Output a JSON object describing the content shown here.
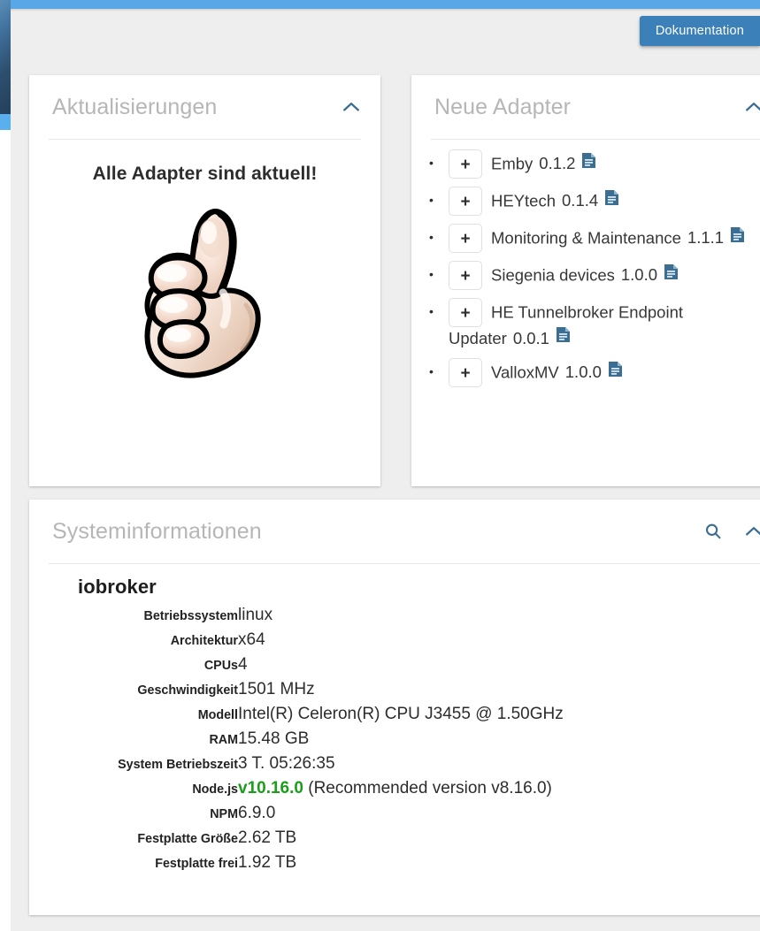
{
  "theme": {
    "topbar_color": "#5aa7e8",
    "sidebar_gradient_top": "#5b8fba",
    "sidebar_gradient_bottom": "#24405c",
    "sidebar_active_color": "#5aafef",
    "page_bg": "#eeeeee",
    "card_bg": "#ffffff",
    "accent_button_color": "#3b80b8",
    "icon_blue": "#3c6e92",
    "card_title_color": "#b6b6b6",
    "node_ok_color": "#1a9e1a"
  },
  "header": {
    "documentation_button_label": "Dokumentation"
  },
  "updates_card": {
    "title": "Aktualisierungen",
    "collapse_icon": "chevron-up-icon",
    "message": "Alle Adapter sind aktuell!",
    "illustration": "thumbs-up-icon"
  },
  "adapters_card": {
    "title": "Neue Adapter",
    "collapse_icon": "chevron-up-icon",
    "add_button_label": "+",
    "doc_icon": "document-icon",
    "items": [
      {
        "name": "Emby",
        "version": "0.1.2"
      },
      {
        "name": "HEYtech",
        "version": "0.1.4"
      },
      {
        "name": "Monitoring & Maintenance",
        "version": "1.1.1"
      },
      {
        "name": "Siegenia devices",
        "version": "1.0.0"
      },
      {
        "name": "HE Tunnelbroker Endpoint Updater",
        "version": "0.0.1"
      },
      {
        "name": "ValloxMV",
        "version": "1.0.0"
      }
    ]
  },
  "sysinfo_card": {
    "title": "Systeminformationen",
    "search_icon": "search-icon",
    "collapse_icon": "chevron-up-icon",
    "host": "iobroker",
    "rows": [
      {
        "label": "Betriebssystem",
        "value": "linux"
      },
      {
        "label": "Architektur",
        "value": "x64"
      },
      {
        "label": "CPUs",
        "value": "4"
      },
      {
        "label": "Geschwindigkeit",
        "value": "1501 MHz"
      },
      {
        "label": "Modell",
        "value": "Intel(R) Celeron(R) CPU J3455 @ 1.50GHz"
      },
      {
        "label": "RAM",
        "value": "15.48 GB"
      },
      {
        "label": "System Betriebszeit",
        "value": "3 T. 05:26:35"
      },
      {
        "label": "Node.js",
        "value": "v10.16.0 (Recommended version v8.16.0)",
        "highlight": "v10.16.0",
        "rest": " (Recommended version v8.16.0)"
      },
      {
        "label": "NPM",
        "value": "6.9.0"
      },
      {
        "label": "Festplatte Größe",
        "value": "2.62 TB"
      },
      {
        "label": "Festplatte frei",
        "value": "1.92 TB"
      }
    ]
  }
}
